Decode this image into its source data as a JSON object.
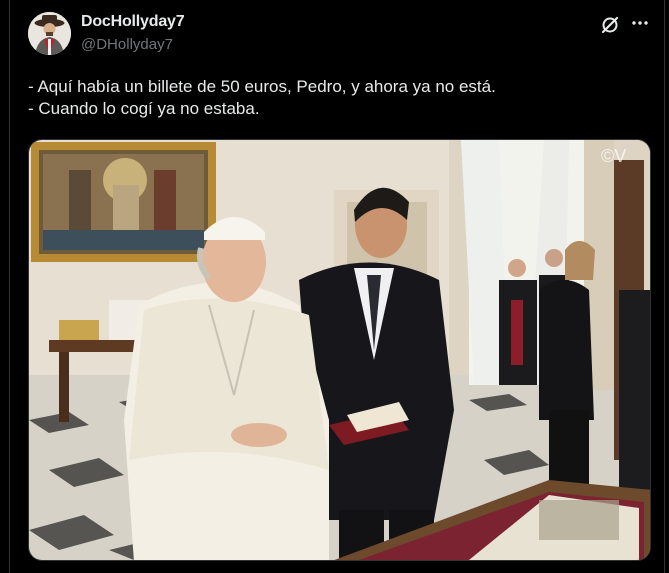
{
  "author": {
    "display_name": "DocHollyday7",
    "handle": "@DHollyday7"
  },
  "tweet": {
    "lines": [
      "- Aquí había un billete de 50 euros, Pedro, y ahora ya no está.",
      "- Cuando lo cogí ya no estaba."
    ]
  },
  "media": {
    "watermark": "©V"
  },
  "icons": {
    "grok": "grok-icon",
    "more": "more-options-icon"
  },
  "colors": {
    "background": "#000000",
    "text": "#e7e9ea",
    "secondary_text": "#71767b",
    "border": "#2f3336"
  }
}
